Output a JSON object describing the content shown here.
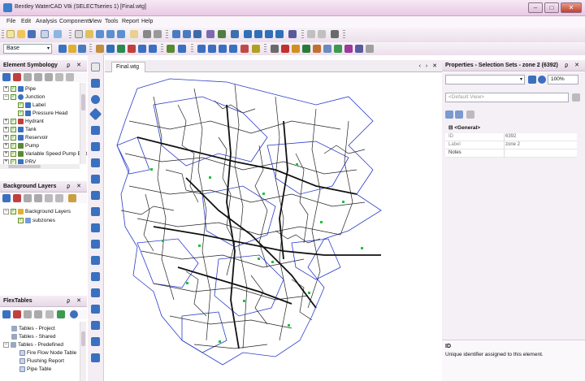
{
  "window": {
    "title": "Bentley WaterCAD V8i (SELECTseries 1) [Final.wtg]",
    "min": "–",
    "max": "□",
    "close": "✕"
  },
  "menu": [
    "File",
    "Edit",
    "Analysis",
    "Components",
    "View",
    "Tools",
    "Report",
    "Help"
  ],
  "scenario_combo": {
    "value": "Base",
    "arrow": "▾"
  },
  "element_symbology": {
    "title": "Element Symbology",
    "controls": "ϼ ✕",
    "items": [
      {
        "label": "Pipe",
        "level": 0,
        "expander": "+",
        "icon_color": "#3a70c0"
      },
      {
        "label": "Junction",
        "level": 0,
        "expander": "−",
        "icon_color": "#3a70c0"
      },
      {
        "label": "Label",
        "level": 1,
        "expander": "",
        "icon_color": "#3a70c0"
      },
      {
        "label": "Pressure Head",
        "level": 1,
        "expander": "",
        "icon_color": "#3a70c0"
      },
      {
        "label": "Hydrant",
        "level": 0,
        "expander": "+",
        "icon_color": "#c04040"
      },
      {
        "label": "Tank",
        "level": 0,
        "expander": "+",
        "icon_color": "#3a70c0"
      },
      {
        "label": "Reservoir",
        "level": 0,
        "expander": "+",
        "icon_color": "#3a70c0"
      },
      {
        "label": "Pump",
        "level": 0,
        "expander": "+",
        "icon_color": "#5a8a30"
      },
      {
        "label": "Variable Speed Pump Batt",
        "level": 0,
        "expander": "+",
        "icon_color": "#5a8a30"
      },
      {
        "label": "PRV",
        "level": 0,
        "expander": "+",
        "icon_color": "#3a70c0"
      }
    ]
  },
  "background_layers": {
    "title": "Background Layers",
    "controls": "ϼ ✕",
    "items": [
      {
        "label": "Background Layers",
        "level": 0,
        "expander": "−"
      },
      {
        "label": "subzones",
        "level": 1,
        "expander": ""
      }
    ]
  },
  "flextables": {
    "title": "FlexTables",
    "controls": "ϼ ✕",
    "items": [
      {
        "label": "Tables - Project",
        "level": 0,
        "expander": ""
      },
      {
        "label": "Tables - Shared",
        "level": 0,
        "expander": ""
      },
      {
        "label": "Tables - Predefined",
        "level": 0,
        "expander": "−"
      },
      {
        "label": "Fire Flow Node Table",
        "level": 1,
        "expander": ""
      },
      {
        "label": "Flushing Report",
        "level": 1,
        "expander": ""
      },
      {
        "label": "Pipe Table",
        "level": 1,
        "expander": ""
      }
    ]
  },
  "drawing": {
    "tab": "Final.wtg",
    "nav": "‹ › ✕"
  },
  "properties": {
    "title": "Properties - Selection Sets - zone 2 (6392)",
    "controls": "ϼ ✕",
    "zoom": "100%",
    "view_combo": "<Default View>",
    "group": "<General>",
    "rows": [
      {
        "key": "ID",
        "value": "6392"
      },
      {
        "key": "Label",
        "value": "zone 2"
      },
      {
        "key": "Notes",
        "value": ""
      }
    ],
    "desc_title": "ID",
    "desc_text": "Unique identifier assigned to this element."
  },
  "colors": {
    "pipe_blue": "#2a3cc8",
    "pipe_black": "#111111",
    "node_green": "#22c040"
  }
}
